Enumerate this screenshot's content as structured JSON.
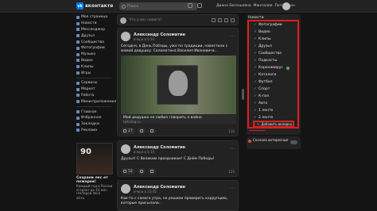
{
  "header": {
    "logo_mark": "vk",
    "logo_text": "вконтакте",
    "search_placeholder": "Поиск",
    "user_menu": [
      "Диана Евгеньевна",
      "Манпалия",
      "Почтальон"
    ]
  },
  "left_nav": {
    "items": [
      "Моя страница",
      "Новости",
      "Мессенджер",
      "Друзья",
      "Сообщества",
      "Фотографии",
      "Музыка",
      "Видео",
      "Клипы",
      "Игры"
    ],
    "items2": [
      "Сервисы",
      "Маркет",
      "Работа",
      "Мини-приложения"
    ],
    "items3": [
      "Главная",
      "Избранное",
      "Закладки",
      "Реклама"
    ]
  },
  "ad": {
    "badge": "90",
    "title": "Сохрани лес от пожаров!",
    "text": "Каждый год в России сгорает до 10 млн гектаров леса",
    "caption": "zd.ru"
  },
  "compose": {
    "placeholder": "Что у вас нового?"
  },
  "posts": [
    {
      "author": "Александр Соломатин",
      "date": "вчера в 5:34",
      "text": "Сегодня, в День Победы, уже по традиции, навестили с мамой дедушку. Соломатина Василия Ивановича...",
      "link_title": "Мой дедушка не любил говорить о войне",
      "link_domain": "tallinfog.ru",
      "likes": "27",
      "comments": "",
      "reposts": "",
      "views": "110"
    },
    {
      "author": "Александр Соломатин",
      "date": "вчера в 5:34",
      "text": "Друзья! С Великим праздником! С Днём Победы!",
      "likes": "52",
      "comments": "",
      "reposts": "",
      "views": "125"
    },
    {
      "author": "Александр Соломатин",
      "date": "вчера в 23:45",
      "text": "Как-то с самого утра, не решили проверить коррупцию, которые присылали.."
    }
  ],
  "news_panel": {
    "title": "Новости",
    "filters": [
      {
        "label": "Фотографии",
        "checked": true
      },
      {
        "label": "Видео",
        "checked": true
      },
      {
        "label": "Клипы",
        "checked": true
      },
      {
        "label": "Друзья",
        "checked": true
      },
      {
        "label": "Сообщества",
        "checked": true
      },
      {
        "label": "Подкасты",
        "checked": true
      },
      {
        "label": "Коронавирус",
        "checked": true,
        "badge": true
      },
      {
        "label": "Каталоги",
        "checked": true
      },
      {
        "label": "Футбол",
        "checked": true
      },
      {
        "label": "Спорт",
        "checked": true
      },
      {
        "label": "К-поп",
        "checked": true
      },
      {
        "label": "Авто",
        "checked": true
      },
      {
        "label": "1 ленте",
        "checked": true
      },
      {
        "label": "2 ленте",
        "checked": true
      }
    ],
    "add_tab_label": "Добавить вкладку",
    "recommendations_label": "Сначала интересные"
  },
  "colors": {
    "accent": "#0077ff",
    "highlight": "#e01c1c",
    "check": "#71aaeb",
    "background": "#141414",
    "panel": "#222222"
  }
}
